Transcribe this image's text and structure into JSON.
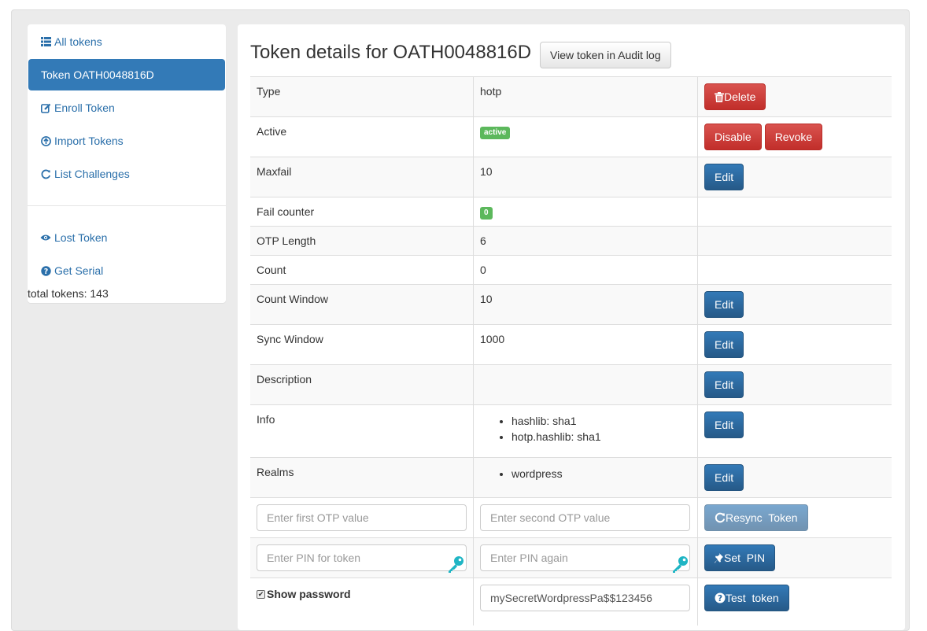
{
  "sidebar": {
    "items": [
      {
        "label": "All tokens",
        "icon": "list-icon"
      },
      {
        "label": "Token OATH0048816D",
        "icon": ""
      },
      {
        "label": "Enroll Token",
        "icon": "edit-icon"
      },
      {
        "label": "Import Tokens",
        "icon": "upload-icon"
      },
      {
        "label": "List Challenges",
        "icon": "refresh-icon"
      }
    ],
    "lower_items": [
      {
        "label": "Lost Token",
        "icon": "eye-icon"
      },
      {
        "label": "Get Serial",
        "icon": "question-icon"
      }
    ],
    "total": "total tokens: 143"
  },
  "main": {
    "title": "Token details for OATH0048816D",
    "audit_button": "View token in Audit log",
    "rows": {
      "type": {
        "label": "Type",
        "value": "hotp",
        "button": "Delete"
      },
      "active": {
        "label": "Active",
        "badge": "active",
        "disable": "Disable",
        "revoke": "Revoke"
      },
      "maxfail": {
        "label": "Maxfail",
        "value": "10",
        "button": "Edit"
      },
      "failcounter": {
        "label": "Fail counter",
        "badge": "0"
      },
      "otplen": {
        "label": "OTP Length",
        "value": "6"
      },
      "count": {
        "label": "Count",
        "value": "0"
      },
      "countwindow": {
        "label": "Count Window",
        "value": "10",
        "button": "Edit"
      },
      "syncwindow": {
        "label": "Sync Window",
        "value": "1000",
        "button": "Edit"
      },
      "description": {
        "label": "Description",
        "value": "",
        "button": "Edit"
      },
      "info": {
        "label": "Info",
        "values": [
          "hashlib: sha1",
          "hotp.hashlib: sha1"
        ],
        "button": "Edit"
      },
      "realms": {
        "label": "Realms",
        "values": [
          "wordpress"
        ],
        "button": "Edit"
      }
    },
    "resync": {
      "otp1_placeholder": "Enter first OTP value",
      "otp2_placeholder": "Enter second OTP value",
      "button": "Resync  Token"
    },
    "setpin": {
      "pin1_placeholder": "Enter PIN for token",
      "pin2_placeholder": "Enter PIN again",
      "button": "Set  PIN"
    },
    "test": {
      "show_password": "Show password",
      "password_value": "mySecretWordpressPa$$123456",
      "button": "Test  token"
    }
  },
  "colors": {
    "primary": "#337ab7",
    "danger": "#d9534f",
    "success": "#5cb85c",
    "key_icon": "#1fb5c4"
  }
}
